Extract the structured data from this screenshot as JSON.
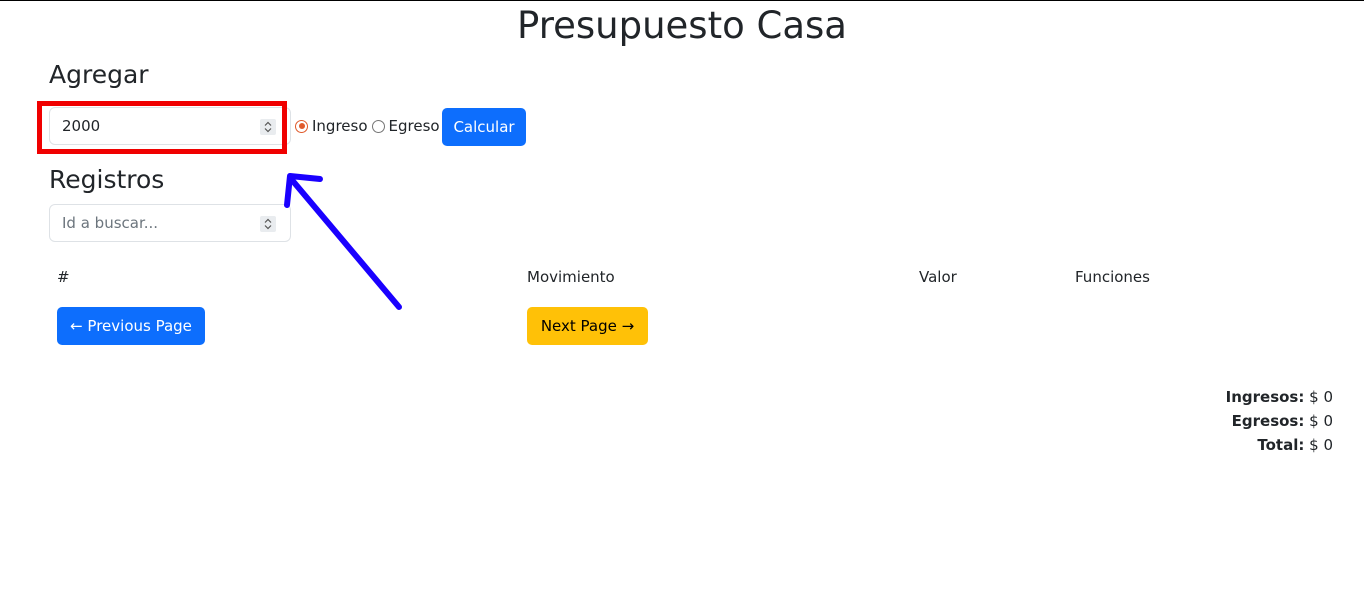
{
  "page": {
    "title": "Presupuesto Casa"
  },
  "agregar": {
    "heading": "Agregar",
    "amount_value": "2000",
    "radio_options": [
      "Ingreso",
      "Egreso"
    ],
    "selected_option": "Ingreso",
    "calculate_label": "Calcular"
  },
  "registros": {
    "heading": "Registros",
    "search_placeholder": "Id a buscar...",
    "columns": [
      "#",
      "Movimiento",
      "Valor",
      "Funciones"
    ],
    "prev_label": "← Previous Page",
    "next_label": "Next Page →"
  },
  "summary": {
    "ingresos_label": "Ingresos:",
    "ingresos_value": "$ 0",
    "egresos_label": "Egresos:",
    "egresos_value": "$ 0",
    "total_label": "Total:",
    "total_value": "$ 0"
  },
  "colors": {
    "primary": "#0d6efd",
    "warning": "#ffc107",
    "highlight": "#f00000",
    "annotation_arrow": "#1a00ff",
    "radio_accent": "#e05a2b"
  }
}
